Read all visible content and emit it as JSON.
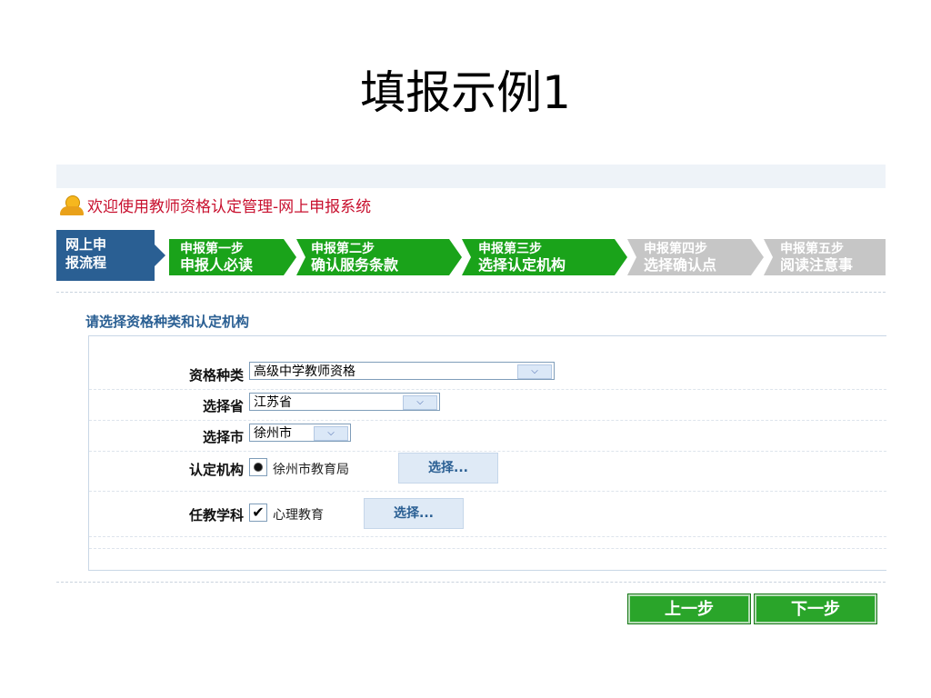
{
  "slide": {
    "title": "填报示例1"
  },
  "app": {
    "welcome": "欢迎使用教师资格认定管理-网上申报系统"
  },
  "steps": {
    "label_line1": "网上申",
    "label_line2": "报流程",
    "items": [
      {
        "line1": "申报第一步",
        "line2": "申报人必读",
        "state": "active"
      },
      {
        "line1": "申报第二步",
        "line2": "确认服务条款",
        "state": "active"
      },
      {
        "line1": "申报第三步",
        "line2": "选择认定机构",
        "state": "active"
      },
      {
        "line1": "申报第四步",
        "line2": "选择确认点",
        "state": "inactive"
      },
      {
        "line1": "申报第五步",
        "line2": "阅读注意事",
        "state": "inactive"
      }
    ]
  },
  "form": {
    "section_title": "请选择资格种类和认定机构",
    "qualification": {
      "label": "资格种类",
      "value": "高级中学教师资格"
    },
    "province": {
      "label": "选择省",
      "value": "江苏省"
    },
    "city": {
      "label": "选择市",
      "value": "徐州市"
    },
    "agency": {
      "label": "认定机构",
      "value": "徐州市教育局",
      "button": "选择...",
      "selected": true
    },
    "subject": {
      "label": "任教学科",
      "value": "心理教育",
      "button": "选择...",
      "checked": true
    }
  },
  "nav": {
    "prev": "上一步",
    "next": "下一步"
  },
  "colors": {
    "step_active": "#1aa31a",
    "step_inactive": "#c6c6c6",
    "label_blue": "#2a5f93",
    "welcome_red": "#c8102e"
  }
}
